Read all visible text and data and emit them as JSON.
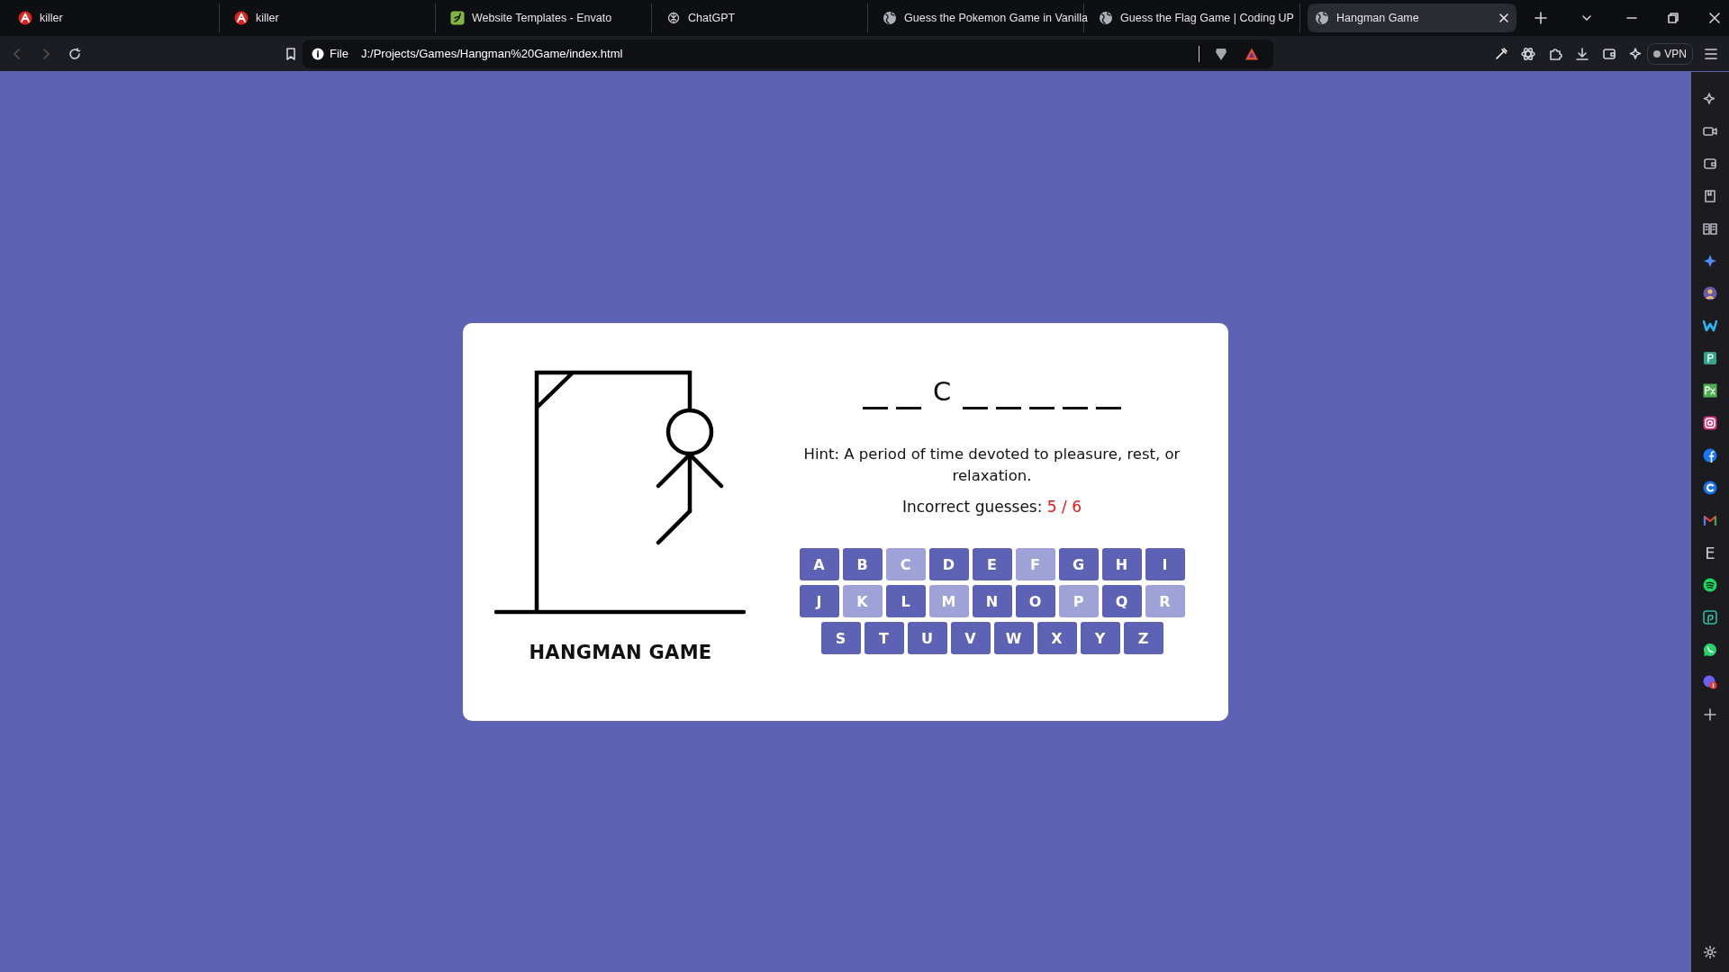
{
  "tabs": [
    {
      "title": "killer",
      "kind": "a-logo",
      "selected": false
    },
    {
      "title": "killer",
      "kind": "a-logo",
      "selected": false
    },
    {
      "title": "Website Templates - Envato",
      "kind": "leaf-logo",
      "selected": false
    },
    {
      "title": "ChatGPT",
      "kind": "knot",
      "selected": false
    },
    {
      "title": "Guess the Pokemon Game in Vanilla",
      "kind": "globe",
      "selected": false
    },
    {
      "title": "Guess the Flag Game | Coding UP",
      "kind": "globe",
      "selected": false
    },
    {
      "title": "Hangman Game",
      "kind": "globe",
      "selected": true
    }
  ],
  "address_bar": {
    "scheme_label": "File",
    "url": "J:/Projects/Games/Hangman%20Game/index.html"
  },
  "vpn_label": "VPN",
  "sidebar": {
    "items": [
      {
        "kind": "sparkle"
      },
      {
        "kind": "camera"
      },
      {
        "kind": "wallet"
      },
      {
        "kind": "book"
      },
      {
        "kind": "reader"
      },
      {
        "kind": "star"
      },
      {
        "kind": "avatar"
      },
      {
        "kind": "w-logo"
      },
      {
        "kind": "teal-square"
      },
      {
        "kind": "px"
      },
      {
        "kind": "instagram"
      },
      {
        "kind": "facebook"
      },
      {
        "kind": "c-logo"
      },
      {
        "kind": "mail"
      },
      {
        "kind": "letter",
        "text": "E"
      },
      {
        "kind": "spotify"
      },
      {
        "kind": "swirl"
      },
      {
        "kind": "whatsapp"
      },
      {
        "kind": "messenger"
      },
      {
        "kind": "plus"
      }
    ]
  },
  "game": {
    "title": "HANGMAN GAME",
    "hangman": {
      "parts": [
        {
          "kind": "head"
        },
        {
          "kind": "body"
        },
        {
          "kind": "left-arm"
        },
        {
          "kind": "right-arm"
        },
        {
          "kind": "left-leg"
        }
      ]
    },
    "word": [
      {
        "revealed": false
      },
      {
        "revealed": false
      },
      {
        "revealed": true,
        "letter": "C"
      },
      {
        "revealed": false
      },
      {
        "revealed": false
      },
      {
        "revealed": false
      },
      {
        "revealed": false
      },
      {
        "revealed": false
      }
    ],
    "hint_label": "Hint:",
    "hint": "A period of time devoted to pleasure, rest, or relaxation.",
    "guesses_label": "Incorrect guesses:",
    "guesses_value": "5 / 6",
    "keyboard": [
      {
        "letter": "A",
        "disabled": false
      },
      {
        "letter": "B",
        "disabled": false
      },
      {
        "letter": "C",
        "disabled": true
      },
      {
        "letter": "D",
        "disabled": false
      },
      {
        "letter": "E",
        "disabled": false
      },
      {
        "letter": "F",
        "disabled": true
      },
      {
        "letter": "G",
        "disabled": false
      },
      {
        "letter": "H",
        "disabled": false
      },
      {
        "letter": "I",
        "disabled": false
      },
      {
        "letter": "J",
        "disabled": false
      },
      {
        "letter": "K",
        "disabled": true
      },
      {
        "letter": "L",
        "disabled": false
      },
      {
        "letter": "M",
        "disabled": true
      },
      {
        "letter": "N",
        "disabled": false
      },
      {
        "letter": "O",
        "disabled": false
      },
      {
        "letter": "P",
        "disabled": true
      },
      {
        "letter": "Q",
        "disabled": false
      },
      {
        "letter": "R",
        "disabled": true
      },
      {
        "letter": "S",
        "disabled": false
      },
      {
        "letter": "T",
        "disabled": false
      },
      {
        "letter": "U",
        "disabled": false
      },
      {
        "letter": "V",
        "disabled": false
      },
      {
        "letter": "W",
        "disabled": false
      },
      {
        "letter": "X",
        "disabled": false
      },
      {
        "letter": "Y",
        "disabled": false
      },
      {
        "letter": "Z",
        "disabled": false
      }
    ]
  }
}
